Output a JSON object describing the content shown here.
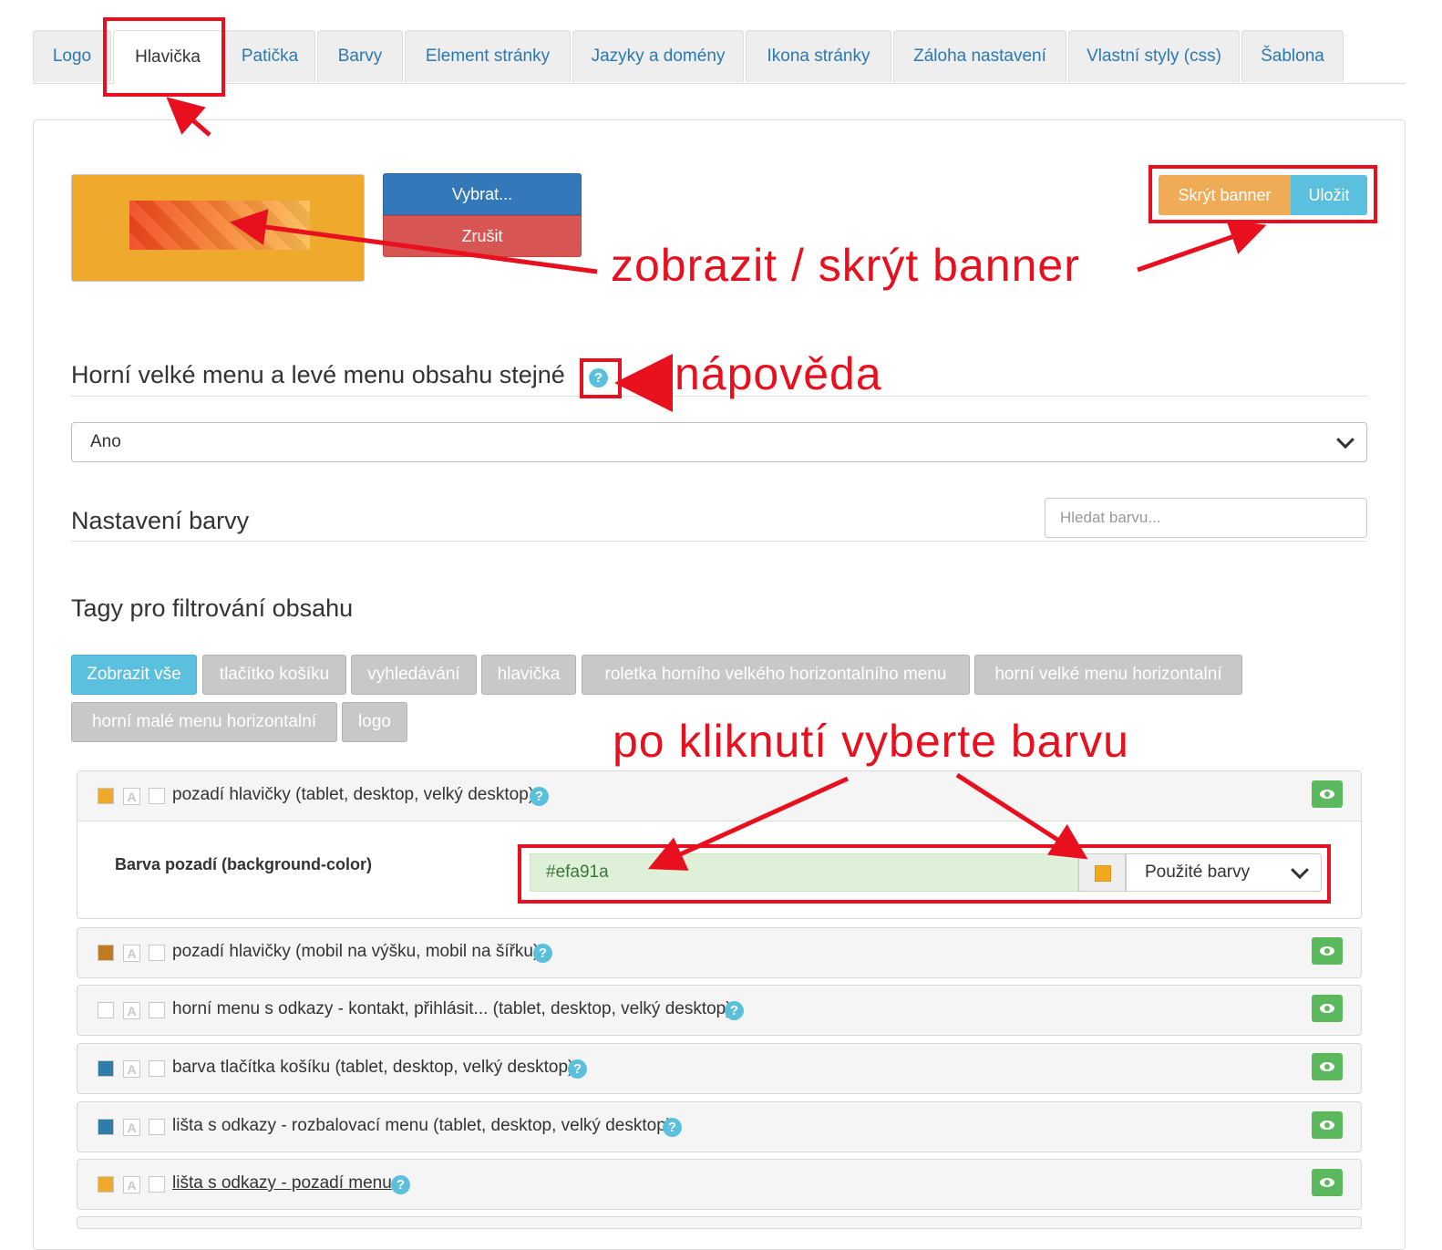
{
  "tabs": [
    "Logo",
    "Hlavička",
    "Patička",
    "Barvy",
    "Element stránky",
    "Jazyky a domény",
    "Ikona stránky",
    "Záloha nastavení",
    "Vlastní styly (css)",
    "Šablona"
  ],
  "banner": {
    "choose_label": "Vybrat...",
    "cancel_label": "Zrušit",
    "hide_label": "Skrýt banner",
    "save_label": "Uložit"
  },
  "menu_setting": {
    "title": "Horní velké menu a levé menu obsahu stejné",
    "help": "?",
    "value": "Ano"
  },
  "colors": {
    "title": "Nastavení barvy",
    "search_placeholder": "Hledat barvu..."
  },
  "tags": {
    "title": "Tagy pro filtrování obsahu",
    "items": [
      "Zobrazit vše",
      "tlačítko košíku",
      "vyhledávání",
      "hlavička",
      "roletka horního velkého horizontalního menu",
      "horní velké menu horizontalní",
      "horní malé menu horizontalní",
      "logo"
    ]
  },
  "expanded_item": {
    "label": "pozadí hlavičky (tablet, desktop, velký desktop)",
    "field_label": "Barva pozadí (background-color)",
    "hex_value": "#efa91a",
    "used_colors_label": "Použité barvy",
    "color": "#efa91a"
  },
  "color_rows": [
    {
      "label": "pozadí hlavičky (mobil na výšku, mobil na šířku)",
      "color": "#c07a20"
    },
    {
      "label": "horní menu s odkazy - kontakt, přihlásit... (tablet, desktop, velký desktop)",
      "color": ""
    },
    {
      "label": "barva tlačítka košíku (tablet, desktop, velký desktop)",
      "color": "#2f7ca6"
    },
    {
      "label": "lišta s odkazy - rozbalovací menu (tablet, desktop, velký desktop)",
      "color": "#2f7ca6"
    },
    {
      "label": "lišta s odkazy - pozadí menu ",
      "color": "#efa92d"
    }
  ],
  "swatch_letter": "A",
  "annotations": {
    "show_hide_banner": "zobrazit / skrýt banner",
    "help": "nápověda",
    "pick_color": "po kliknutí vyberte barvu"
  },
  "accent_colors": {
    "primary": "#3378b8",
    "danger": "#d75552",
    "warning": "#efab55",
    "info": "#5bc0de",
    "success": "#5cb85c",
    "annotation": "#e8101e"
  }
}
